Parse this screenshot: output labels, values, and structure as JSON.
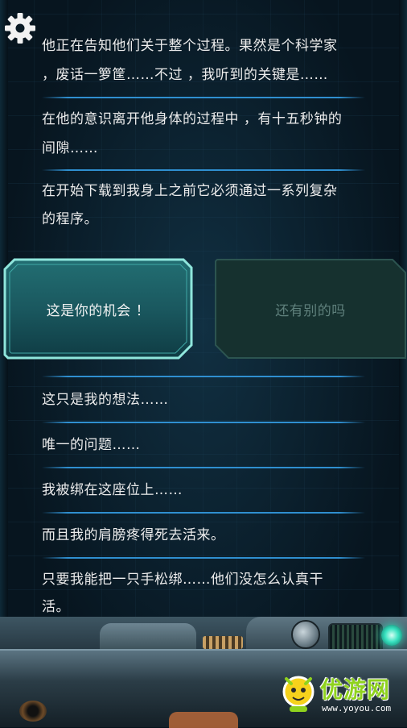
{
  "dialogue_top": [
    {
      "lines": [
        "他正在告知他们关于整个过程。果然是个科学家",
        "，废话一箩筐……不过 ，我听到的关键是……"
      ]
    },
    {
      "lines": [
        "在他的意识离开他身体的过程中 ，有十五秒钟的",
        "间隙……"
      ]
    },
    {
      "lines": [
        "在开始下载到我身上之前它必须通过一系列复杂",
        "的程序。"
      ]
    }
  ],
  "choices": {
    "primary": "这是你的机会 ！",
    "secondary": "还有别的吗"
  },
  "dialogue_bottom": [
    {
      "lines": [
        "这只是我的想法……"
      ]
    },
    {
      "lines": [
        "唯一的问题……"
      ]
    },
    {
      "lines": [
        "我被绑在这座位上……"
      ]
    },
    {
      "lines": [
        "而且我的肩膀疼得死去活来。"
      ]
    },
    {
      "lines": [
        "只要我能把一只手松绑……他们没怎么认真干",
        "活。"
      ]
    }
  ],
  "watermark": {
    "brand": "优游网",
    "url": "www.yoyou.com"
  },
  "icons": {
    "settings": "gear-icon",
    "mascot": "mascot-logo"
  },
  "colors": {
    "text": "#ececec",
    "separator": "#2f8fd0",
    "choice_active_border": "#7fe0d6",
    "choice_inactive_text": "#5f807c",
    "status_light": "#38e2c0"
  }
}
